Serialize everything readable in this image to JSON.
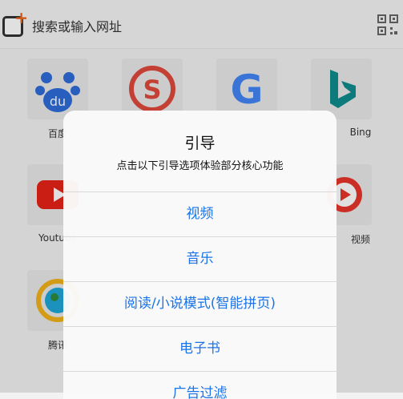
{
  "topbar": {
    "search_placeholder": "搜索或输入网址"
  },
  "shortcuts": [
    {
      "label": "百度",
      "icon": "baidu-icon"
    },
    {
      "label": "",
      "icon": "sogou-icon"
    },
    {
      "label": "",
      "icon": "google-icon"
    },
    {
      "label": "Bing",
      "icon": "bing-icon"
    },
    {
      "label": "Youtube",
      "icon": "youtube-icon"
    },
    {
      "label": "",
      "icon": "blank-icon"
    },
    {
      "label": "",
      "icon": "blank-icon"
    },
    {
      "label": "视频",
      "icon": "video-play-icon"
    },
    {
      "label": "腾讯",
      "icon": "tencent-icon"
    }
  ],
  "dialog": {
    "title": "引导",
    "subtitle": "点击以下引导选项体验部分核心功能",
    "items": [
      "视频",
      "音乐",
      "阅读/小说模式(智能拼页)",
      "电子书",
      "广告过滤"
    ]
  },
  "colors": {
    "accent": "#1a73e8",
    "brand_orange": "#f0651a"
  }
}
